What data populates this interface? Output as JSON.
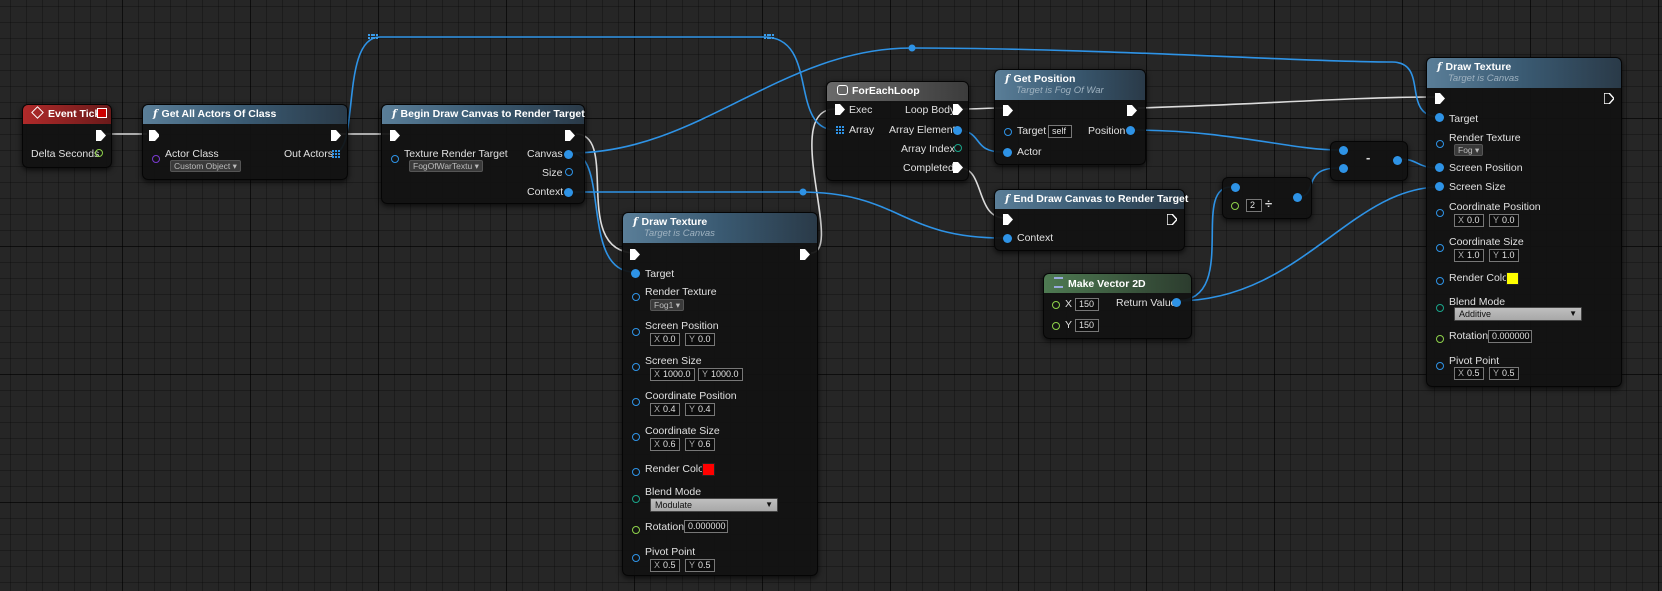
{
  "nodes": {
    "event_tick": {
      "title": "Event Tick",
      "delta": "Delta Seconds"
    },
    "get_all_actors": {
      "title": "Get All Actors Of Class",
      "actor_class": "Actor Class",
      "actor_class_value": "Custom Object",
      "out_actors": "Out Actors"
    },
    "begin_draw": {
      "title": "Begin Draw Canvas to Render Target",
      "texture_rt": "Texture Render Target",
      "texture_rt_value": "FogOfWarTextu",
      "canvas": "Canvas",
      "size": "Size",
      "context": "Context"
    },
    "foreach": {
      "title": "ForEachLoop",
      "exec": "Exec",
      "array": "Array",
      "loop_body": "Loop Body",
      "array_element": "Array Element",
      "array_index": "Array Index",
      "completed": "Completed"
    },
    "get_position": {
      "title": "Get Position",
      "subtitle": "Target is Fog Of War",
      "target": "Target",
      "self": "self",
      "position": "Position",
      "actor": "Actor"
    },
    "end_draw": {
      "title": "End Draw Canvas to Render Target",
      "context": "Context"
    },
    "make_vector": {
      "title": "Make Vector 2D",
      "x_label": "X",
      "x_value": "150",
      "y_label": "Y",
      "y_value": "150",
      "return_value": "Return Value"
    },
    "divide": {
      "symbol": "÷",
      "value": "2"
    },
    "subtract": {
      "symbol": "-"
    },
    "draw_texture_1": {
      "title": "Draw Texture",
      "subtitle": "Target is Canvas",
      "target": "Target",
      "render_texture": "Render Texture",
      "render_texture_value": "Fog1",
      "screen_position": "Screen Position",
      "sp_x": "0.0",
      "sp_y": "0.0",
      "screen_size": "Screen Size",
      "ss_x": "1000.0",
      "ss_y": "1000.0",
      "coordinate_position": "Coordinate Position",
      "cp_x": "0.4",
      "cp_y": "0.4",
      "coordinate_size": "Coordinate Size",
      "cs_x": "0.6",
      "cs_y": "0.6",
      "render_color": "Render Color",
      "render_color_hex": "#ff0000",
      "blend_mode": "Blend Mode",
      "blend_mode_value": "Modulate",
      "rotation": "Rotation",
      "rotation_value": "0.000000",
      "pivot_point": "Pivot Point",
      "pp_x": "0.5",
      "pp_y": "0.5"
    },
    "draw_texture_2": {
      "title": "Draw Texture",
      "subtitle": "Target is Canvas",
      "target": "Target",
      "render_texture": "Render Texture",
      "render_texture_value": "Fog",
      "screen_position": "Screen Position",
      "screen_size": "Screen Size",
      "coordinate_position": "Coordinate Position",
      "cp_x": "0.0",
      "cp_y": "0.0",
      "coordinate_size": "Coordinate Size",
      "cs_x": "1.0",
      "cs_y": "1.0",
      "render_color": "Render Color",
      "render_color_hex": "#ffff00",
      "blend_mode": "Blend Mode",
      "blend_mode_value": "Additive",
      "rotation": "Rotation",
      "rotation_value": "0.000000",
      "pivot_point": "Pivot Point",
      "pp_x": "0.5",
      "pp_y": "0.5"
    }
  },
  "axis": {
    "x": "X",
    "y": "Y"
  },
  "colors": {
    "exec": "#ffffff",
    "object": "#2e93e6",
    "float": "#8ed24a",
    "int": "#1aa58a",
    "class": "#7a3ad0",
    "struct": "#2e93e6"
  }
}
